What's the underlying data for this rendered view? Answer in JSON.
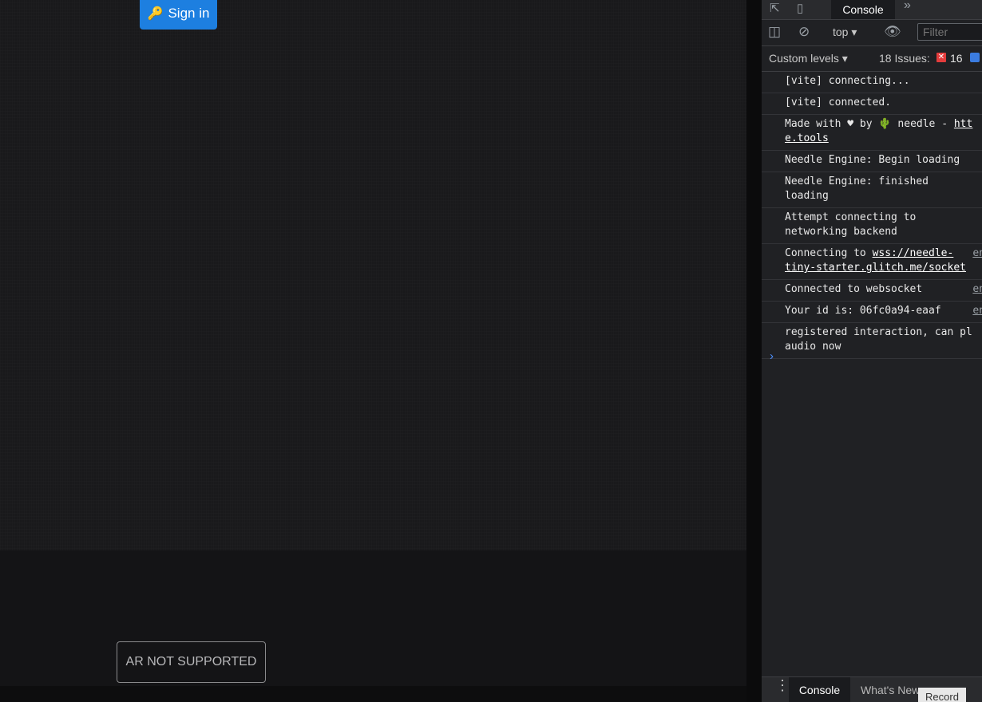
{
  "app": {
    "signin_icon": "key-icon",
    "signin_label": "Sign in",
    "ar_button_label": "AR NOT SUPPORTED",
    "colors": {
      "signin_bg": "#1d7fe0",
      "background": "#19191b"
    }
  },
  "devtools": {
    "tabs": {
      "console": "Console",
      "more_icon": "»"
    },
    "toolbar": {
      "context": "top ▾",
      "filter_placeholder": "Filter",
      "levels": "Custom levels ▾",
      "issues_label": "18 Issues:",
      "error_count": "16"
    },
    "messages": [
      {
        "text": "[vite] connecting..."
      },
      {
        "text": "[vite] connected."
      },
      {
        "pre": "Made with ♥ by 🌵 needle - ",
        "link": "htt",
        "link2": "e.tools"
      },
      {
        "text": "Needle Engine: Begin loading"
      },
      {
        "text": "Needle Engine: finished\nloading"
      },
      {
        "text": "Attempt connecting to\nnetworking backend"
      },
      {
        "pre": "Connecting to ",
        "link": "wss://needle-",
        "link2": "tiny-starter.glitch.me/socket",
        "src": "en"
      },
      {
        "text": "Connected to websocket",
        "src": "en"
      },
      {
        "text": "Your id is: 06fc0a94-eaaf",
        "src": "en"
      },
      {
        "text": "registered interaction, can pl\naudio now"
      }
    ],
    "prompt": "›",
    "bottom": {
      "console": "Console",
      "whats_new": "What's New",
      "record": "Record"
    }
  }
}
